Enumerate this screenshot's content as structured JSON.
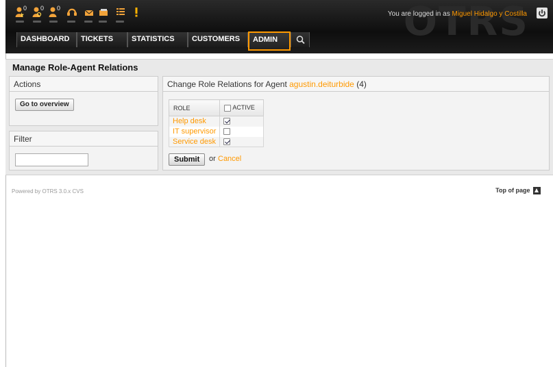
{
  "header": {
    "watermark": "OTRS",
    "login_prefix": "You are logged in as",
    "user_name": "Miguel Hidalgo y Costilla",
    "toolbar": [
      {
        "icon": "new-tickets-icon",
        "badge": "0"
      },
      {
        "icon": "watched-tickets-icon",
        "badge": "0"
      },
      {
        "icon": "responsible-tickets-icon",
        "badge": "0"
      },
      {
        "icon": "phone-ticket-icon"
      },
      {
        "icon": "email-ticket-icon"
      },
      {
        "icon": "locked-tickets-icon"
      },
      {
        "icon": "queue-view-icon"
      },
      {
        "icon": "escalation-icon"
      }
    ]
  },
  "nav": {
    "dashboard": "DASHBOARD",
    "tickets": "TICKETS",
    "statistics": "STATISTICS",
    "customers": "CUSTOMERS",
    "admin": "ADMIN"
  },
  "page": {
    "title": "Manage Role-Agent Relations"
  },
  "sidebar": {
    "actions_title": "Actions",
    "overview_button": "Go to overview",
    "filter_title": "Filter",
    "filter_value": ""
  },
  "content": {
    "heading_prefix": "Change Role Relations for Agent",
    "agent_login": "agustin.deiturbide",
    "agent_id": "(4)",
    "table": {
      "col_role": "ROLE",
      "col_active": "ACTIVE",
      "rows": [
        {
          "role": "Help desk",
          "active": true
        },
        {
          "role": "IT supervisor",
          "active": false
        },
        {
          "role": "Service desk",
          "active": true
        }
      ]
    },
    "submit_label": "Submit",
    "or_text": "or",
    "cancel_label": "Cancel"
  },
  "footer": {
    "powered_by": "Powered by OTRS 3.0.x CVS",
    "top_of_page": "Top of page"
  },
  "colors": {
    "accent": "#ff9900",
    "header_bg": "#141414",
    "panel_bg": "#e9e9e9"
  }
}
